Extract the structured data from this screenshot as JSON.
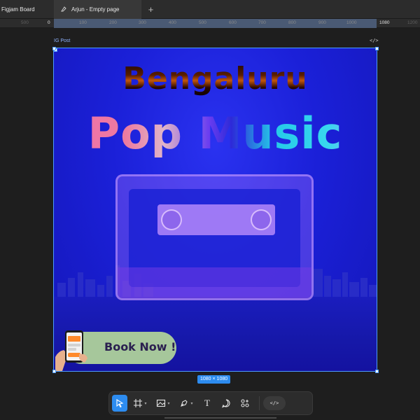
{
  "tabs": [
    {
      "label": "Figjam Board"
    },
    {
      "label": "Arjun - Empty page"
    }
  ],
  "add_tab_label": "+",
  "ruler": {
    "ticks": [
      "500",
      "0",
      "100",
      "200",
      "300",
      "400",
      "500",
      "600",
      "700",
      "800",
      "900",
      "1000",
      "1080",
      "1200"
    ]
  },
  "frame": {
    "name": "IG Post",
    "code_glyph": "</>",
    "size": "1080 × 1080"
  },
  "post": {
    "line1": "Bengaluru",
    "line2": "Pop Music",
    "cta": "Book Now !"
  },
  "toolbar": {
    "dev_glyph": "</>",
    "text_glyph": "T",
    "tools": [
      "move-tool",
      "frame-tool",
      "image-tool",
      "pen-tool",
      "text-tool",
      "comment-tool",
      "actions-tool",
      "dev-mode-toggle"
    ]
  },
  "colors": {
    "accent": "#2d8cf0",
    "frame_bg": "#1b20d8",
    "cta_bg": "#a6c79b",
    "cta_text": "#2a1f4f"
  }
}
